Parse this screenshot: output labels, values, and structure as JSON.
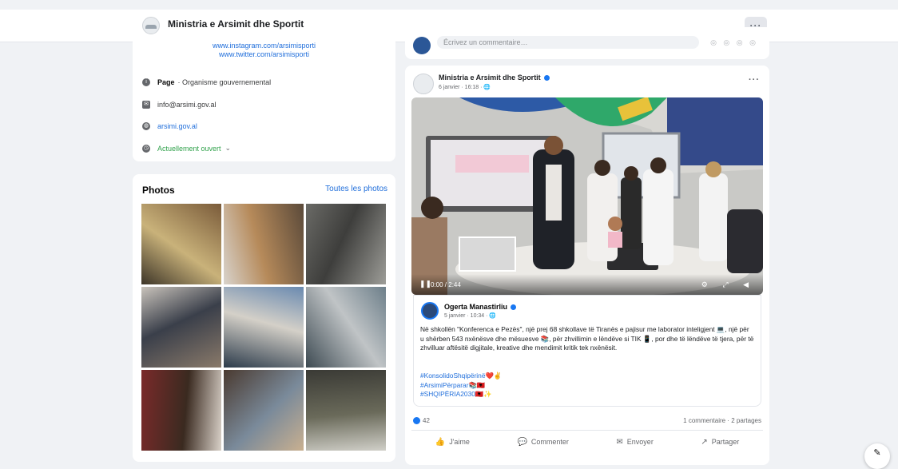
{
  "header": {
    "page_name": "Ministria e Arsimit dhe Sportit",
    "more_label": "···"
  },
  "intro": {
    "social_line1": "www.instagram.com/arsimisporti",
    "social_line2": "www.twitter.com/arsimisporti",
    "page_label": "Page",
    "page_category": "· Organisme gouvernemental",
    "email": "info@arsimi.gov.al",
    "website": "arsimi.gov.al",
    "open_status": "Actuellement ouvert",
    "open_status_chevron": "⌄"
  },
  "photos": {
    "title": "Photos",
    "see_all": "Toutes les photos",
    "items": [
      {
        "label": "classroom-posters",
        "colors": [
          "#3d3528",
          "#c9b27a",
          "#7a5b3a"
        ]
      },
      {
        "label": "presentation-screen",
        "colors": [
          "#d8d3cc",
          "#b68a5a",
          "#5b4a3a"
        ]
      },
      {
        "label": "hands-gray",
        "colors": [
          "#6a6a66",
          "#3e3e3c",
          "#9d9d98"
        ]
      },
      {
        "label": "classroom-board",
        "colors": [
          "#c9c3bb",
          "#3a3f4a",
          "#8a7a6a"
        ]
      },
      {
        "label": "paper-blue",
        "colors": [
          "#6a8ab0",
          "#d4d0c8",
          "#2b3a4a"
        ]
      },
      {
        "label": "slide-projection",
        "colors": [
          "#6d7f8a",
          "#c0c4c6",
          "#3d4a52"
        ]
      },
      {
        "label": "students-reading",
        "colors": [
          "#d9d1c8",
          "#3a2a20",
          "#7a2a2a"
        ]
      },
      {
        "label": "classroom-event",
        "colors": [
          "#c9b090",
          "#7a8a9a",
          "#4a3a30"
        ]
      },
      {
        "label": "classroom-desks",
        "colors": [
          "#d0cfc8",
          "#6a6a5a",
          "#3a3a35"
        ]
      }
    ]
  },
  "composer": {
    "placeholder": "Écrivez un commentaire…",
    "icons": "◎ ◎ ◎ ◎"
  },
  "post": {
    "author": "Ministria e Arsimit dhe Sportit",
    "date": "6 janvier · 16:18 · 🌐",
    "more": "···",
    "video": {
      "play_icon": "❚❚",
      "time": "0:00 / 2:44",
      "right_icons": "⚙ ⤢ ◀"
    },
    "shared": {
      "author": "Ogerta Manastirliu",
      "date": "5 janvier · 10:34 · 🌐",
      "text": "Në shkollën \"Konferenca e Pezës\", një prej 68 shkollave të Tiranës e pajisur me laborator inteligjent 💻, një për u shërben 543 nxënësve dhe mësuesve 📚, për zhvillimin e lëndëve si TIK 📱, por dhe të lëndëve të tjera, për të zhvilluar aftësitë digjitale, kreative dhe mendimit kritik tek nxënësit.",
      "tags": [
        "#KonsolidoShqipërinë❤️✌",
        "#ArsimiPërparar📚🇦🇱",
        "#SHQIPËRIA2030🇦🇱✨"
      ]
    },
    "reaction_count": "42",
    "comments_shares": "1 commentaire · 2 partages",
    "actions": [
      {
        "icon": "👍",
        "label": "J'aime"
      },
      {
        "icon": "💬",
        "label": "Commenter"
      },
      {
        "icon": "✉",
        "label": "Envoyer"
      },
      {
        "icon": "↗",
        "label": "Partager"
      }
    ]
  },
  "fab_icon": "✎"
}
